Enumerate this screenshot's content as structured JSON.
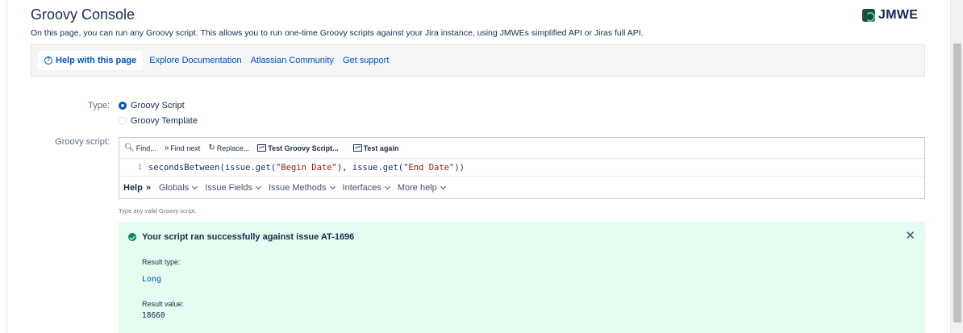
{
  "page": {
    "title": "Groovy Console",
    "subtitle": "On this page, you can run any Groovy script. This allows you to run one-time Groovy scripts against your Jira instance, using JMWEs simplified API or Jiras full API."
  },
  "brand": {
    "name": "JMWE",
    "icon": "jmwe-logo-icon"
  },
  "help_bar": {
    "help_label": "Help with this page",
    "links": [
      "Explore Documentation",
      "Atlassian Community",
      "Get support"
    ]
  },
  "type_field": {
    "label": "Type:",
    "options": [
      {
        "label": "Groovy Script",
        "selected": true
      },
      {
        "label": "Groovy Template",
        "selected": false
      }
    ]
  },
  "script_field": {
    "label": "Groovy script:",
    "toolbar": {
      "find": "Find...",
      "find_next": "Find next",
      "replace": "Replace...",
      "test_script": "Test Groovy Script...",
      "test_again": "Test again"
    },
    "line_number": "1",
    "code": {
      "prefix": "secondsBetween(issue.get(",
      "arg1": "\"Begin Date\"",
      "middle": "), issue.get(",
      "arg2": "\"End Date\"",
      "suffix": "))"
    },
    "help_menu": {
      "help_label": "Help",
      "items": [
        "Globals",
        "Issue Fields",
        "Issue Methods",
        "Interfaces",
        "More help"
      ]
    },
    "hint": "Type any valid Groovy script."
  },
  "result": {
    "message": "Your script ran successfully against issue AT-1696",
    "type_label": "Result type:",
    "type_value": "Long",
    "value_label": "Result value:",
    "value": "18660",
    "status_color": "#00875a",
    "background": "#e3fcef"
  }
}
